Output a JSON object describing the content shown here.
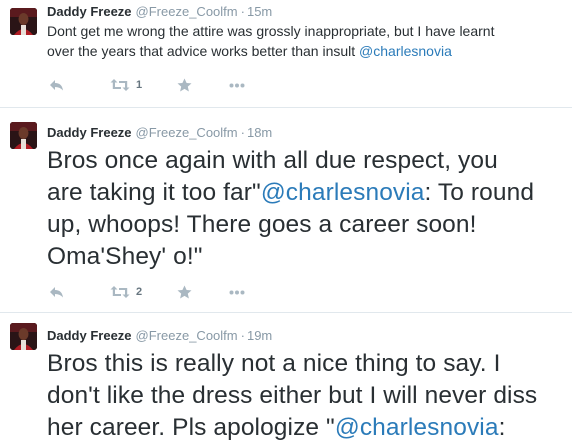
{
  "tweets": [
    {
      "name": "Daddy Freeze",
      "handle": "@Freeze_Coolfm",
      "separator": "·",
      "time": "15m",
      "lines": [
        {
          "text": "Dont get me wrong the attire was grossly inappropriate, but I have learnt"
        },
        {
          "text": "over the years that advice works better than insult ",
          "mention": "@charlesnovia"
        }
      ],
      "retweet_count": "1"
    },
    {
      "name": "Daddy Freeze",
      "handle": "@Freeze_Coolfm",
      "separator": "·",
      "time": "18m",
      "lines": [
        {
          "text": "Bros once again with all due respect, you"
        },
        {
          "text": "are taking it too far\"",
          "mention": "@charlesnovia",
          "after": ": To round"
        },
        {
          "text": "up, whoops! There goes a career soon!"
        },
        {
          "text": "Oma'Shey' o!\""
        }
      ],
      "retweet_count": "2"
    },
    {
      "name": "Daddy Freeze",
      "handle": "@Freeze_Coolfm",
      "separator": "·",
      "time": "19m",
      "lines": [
        {
          "text": "Bros this is really not a nice thing to say. I"
        },
        {
          "text": "don't like the dress either but I will never diss"
        },
        {
          "text": "her career. Pls apologize \"",
          "mention": "@charlesnovia",
          "after": ":"
        }
      ]
    }
  ],
  "icons": {
    "reply": "reply-icon",
    "retweet": "retweet-icon",
    "favorite": "star-icon",
    "more": "more-icon"
  },
  "colors": {
    "text": "#292f33",
    "meta": "#8899a6",
    "mention": "#2b7bb9",
    "icon": "#aab8c2",
    "divider": "#e1e8ed"
  }
}
